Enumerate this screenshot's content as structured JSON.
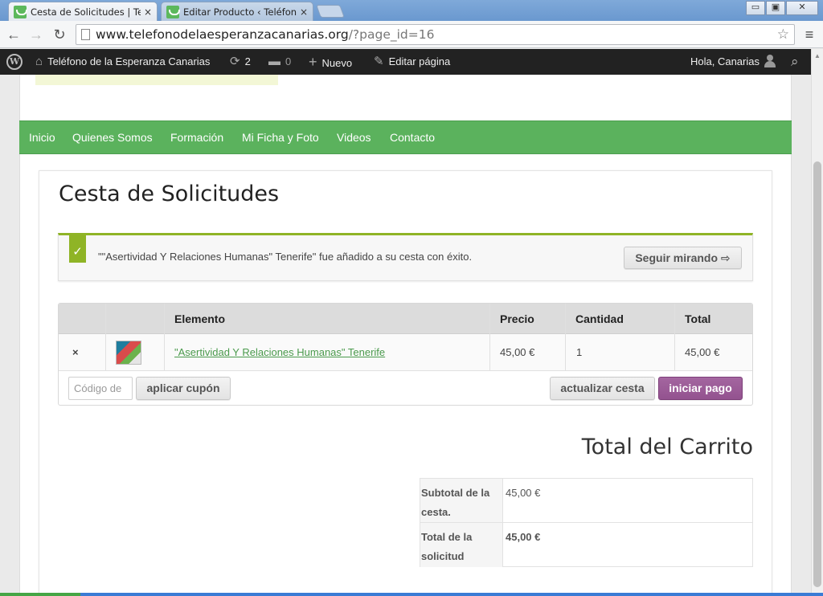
{
  "browser": {
    "tabs": [
      {
        "title": "Cesta de Solicitudes | Teléfono de la",
        "close": "×"
      },
      {
        "title": "Editar Producto ‹ Teléfono de la Esperanza",
        "close": "×"
      }
    ],
    "window_buttons": {
      "minimize": "▭",
      "restore": "▣",
      "close": "✕"
    },
    "nav": {
      "back": "←",
      "forward": "→",
      "reload": "↻"
    },
    "url": {
      "host": "www.telefonodelaesperanzacanarias.org",
      "path": "/?page_id=16"
    },
    "star": "☆",
    "menu": "≡"
  },
  "adminbar": {
    "wp_logo": "W",
    "site_name": "Teléfono de la Esperanza Canarias",
    "updates_count": "2",
    "comments_count": "0",
    "new_label": "Nuevo",
    "edit_label": "Editar página",
    "greeting": "Hola, Canarias",
    "icons": {
      "home": "⌂",
      "updates": "⟳",
      "comments": "▬",
      "new": "+",
      "edit": "✎",
      "search": "⌕"
    }
  },
  "nav": {
    "items": [
      "Inicio",
      "Quienes Somos",
      "Formación",
      "Mi Ficha y Foto",
      "Videos",
      "Contacto"
    ]
  },
  "page": {
    "title": "Cesta de Solicitudes"
  },
  "notice": {
    "check": "✓",
    "message": "\"\"Asertividad Y Relaciones Humanas\" Tenerife\" fue añadido a su cesta con éxito.",
    "button": "Seguir mirando ⇨"
  },
  "cart": {
    "headers": {
      "product": "Elemento",
      "price": "Precio",
      "quantity": "Cantidad",
      "total": "Total"
    },
    "items": [
      {
        "remove": "×",
        "name": "\"Asertividad Y Relaciones Humanas\" Tenerife",
        "price": "45,00 €",
        "quantity": "1",
        "total": "45,00 €"
      }
    ],
    "coupon_placeholder": "Código de",
    "apply_coupon": "aplicar cupón",
    "update_cart": "actualizar cesta",
    "checkout": "iniciar pago"
  },
  "totals": {
    "title": "Total del Carrito",
    "subtotal_label": "Subtotal de la cesta.",
    "subtotal_value": "45,00 €",
    "total_label": "Total de la solicitud",
    "total_value": "45,00 €"
  },
  "colors": {
    "nav_green": "#5bb25d",
    "notice_green": "#8fb426",
    "checkout_purple": "#9b5c97",
    "remove_red": "#dd0000"
  }
}
